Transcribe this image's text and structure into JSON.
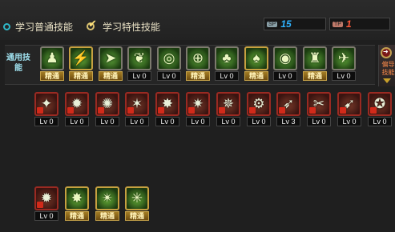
{
  "header": {
    "options": [
      {
        "label": "学习普通技能",
        "icon": "radio-bullet-icon"
      },
      {
        "label": "学习特性技能",
        "icon": "checkmark-icon"
      }
    ],
    "counters": [
      {
        "tag": "SP",
        "value": "15",
        "color": "#2fb3ff"
      },
      {
        "tag": "TP",
        "value": "1",
        "color": "#ff5a3a"
      }
    ]
  },
  "left_category": {
    "label": "通用技能"
  },
  "right_category": {
    "label": "偏导技能",
    "icon": "arrow-icon"
  },
  "rows": [
    {
      "name": "common-skills",
      "skills": [
        {
          "style": "g",
          "icon": "sit-icon",
          "glyph": "♟",
          "lv": "精通",
          "mastered": true
        },
        {
          "style": "y",
          "icon": "leap-icon",
          "glyph": "⚡",
          "lv": "精通",
          "mastered": true
        },
        {
          "style": "g",
          "icon": "dash-icon",
          "glyph": "➤",
          "lv": "精通",
          "mastered": true
        },
        {
          "style": "g",
          "icon": "wings-icon",
          "glyph": "❦",
          "lv": "Lv 0",
          "mastered": false
        },
        {
          "style": "g",
          "icon": "target-icon",
          "glyph": "◎",
          "lv": "Lv 0",
          "mastered": false
        },
        {
          "style": "g",
          "icon": "crosshair-icon",
          "glyph": "⊕",
          "lv": "精通",
          "mastered": true
        },
        {
          "style": "g",
          "icon": "mushroom-icon",
          "glyph": "♣",
          "lv": "Lv 0",
          "mastered": false
        },
        {
          "style": "y",
          "icon": "mushroom-burst-icon",
          "glyph": "♠",
          "lv": "精通",
          "mastered": true
        },
        {
          "style": "g",
          "icon": "radar-icon",
          "glyph": "◉",
          "lv": "Lv 0",
          "mastered": false
        },
        {
          "style": "g",
          "icon": "armor-icon",
          "glyph": "♜",
          "lv": "精通",
          "mastered": true
        },
        {
          "style": "g",
          "icon": "runner-icon",
          "glyph": "✈",
          "lv": "Lv 0",
          "mastered": false
        }
      ]
    },
    {
      "name": "class-skills",
      "skills": [
        {
          "style": "r",
          "icon": "blade-icon",
          "glyph": "✦",
          "lv": "Lv 0",
          "mastered": false
        },
        {
          "style": "r",
          "icon": "vehicle-icon",
          "glyph": "✹",
          "lv": "Lv 0",
          "mastered": false
        },
        {
          "style": "r",
          "icon": "explosion-icon",
          "glyph": "✺",
          "lv": "Lv 0",
          "mastered": false
        },
        {
          "style": "r",
          "icon": "slash-icon",
          "glyph": "✶",
          "lv": "Lv 0",
          "mastered": false
        },
        {
          "style": "r",
          "icon": "fire-icon",
          "glyph": "✸",
          "lv": "Lv 0",
          "mastered": false
        },
        {
          "style": "r",
          "icon": "spike-icon",
          "glyph": "✷",
          "lv": "Lv 0",
          "mastered": false
        },
        {
          "style": "r",
          "icon": "flame-icon",
          "glyph": "✵",
          "lv": "Lv 0",
          "mastered": false
        },
        {
          "style": "r",
          "icon": "gear-shot-icon",
          "glyph": "⚙",
          "lv": "Lv 0",
          "mastered": false
        },
        {
          "style": "r",
          "icon": "volley-icon",
          "glyph": "➶",
          "lv": "Lv 3",
          "mastered": false
        },
        {
          "style": "r",
          "icon": "scissors-icon",
          "glyph": "✂",
          "lv": "Lv 0",
          "mastered": false
        },
        {
          "style": "r",
          "icon": "bow-icon",
          "glyph": "➹",
          "lv": "Lv 0",
          "mastered": false
        },
        {
          "style": "r",
          "icon": "swirl-icon",
          "glyph": "✪",
          "lv": "Lv 0",
          "mastered": false
        }
      ]
    },
    {
      "name": "special-skills",
      "skills": [
        {
          "style": "r",
          "icon": "cannon-icon",
          "glyph": "✹",
          "lv": "Lv 0",
          "mastered": false
        },
        {
          "style": "y",
          "icon": "starburst-icon",
          "glyph": "✸",
          "lv": "精通",
          "mastered": true
        },
        {
          "style": "y",
          "icon": "spark-icon",
          "glyph": "✴",
          "lv": "精通",
          "mastered": true
        },
        {
          "style": "y",
          "icon": "storm-icon",
          "glyph": "✳",
          "lv": "精通",
          "mastered": true
        }
      ]
    }
  ]
}
